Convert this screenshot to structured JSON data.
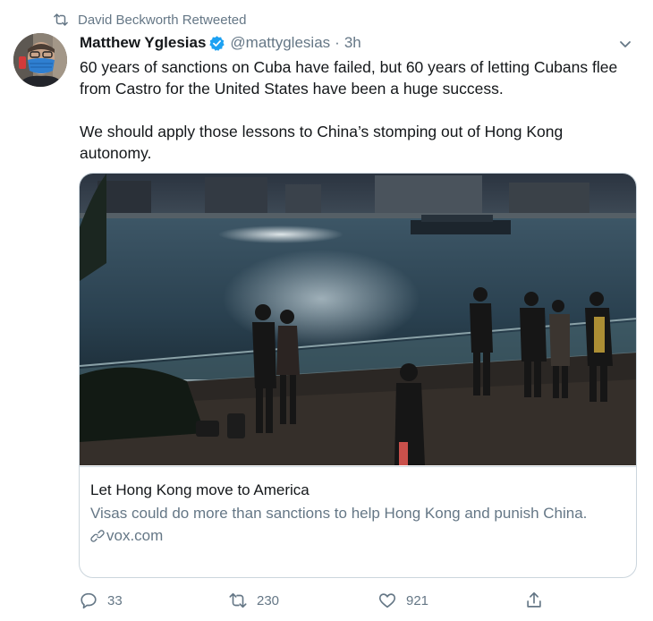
{
  "retweet": {
    "label": "David Beckworth Retweeted",
    "icon": "retweet-icon"
  },
  "author": {
    "name": "Matthew Yglesias",
    "verified": true,
    "handle": "@mattyglesias",
    "separator": "·",
    "time": "3h",
    "avatar": "avatar-man-in-blue-mask"
  },
  "tweet": {
    "paragraphs": [
      "60 years of sanctions on Cuba have failed, but 60 years of letting Cubans flee from Castro for the United States have been a huge success.",
      "We should apply those lessons to China’s stomping out of Hong Kong autonomy."
    ]
  },
  "card": {
    "image": "hong-kong-harbor-at-dusk-photo",
    "title": "Let Hong Kong move to America",
    "description": "Visas could do more than sanctions to help Hong Kong and punish China.",
    "domain": "vox.com"
  },
  "actions": {
    "reply_count": "33",
    "retweet_count": "230",
    "like_count": "921"
  },
  "colors": {
    "text": "#14171a",
    "muted": "#657786",
    "verified": "#1da1f2",
    "border": "#ccd6dd"
  }
}
